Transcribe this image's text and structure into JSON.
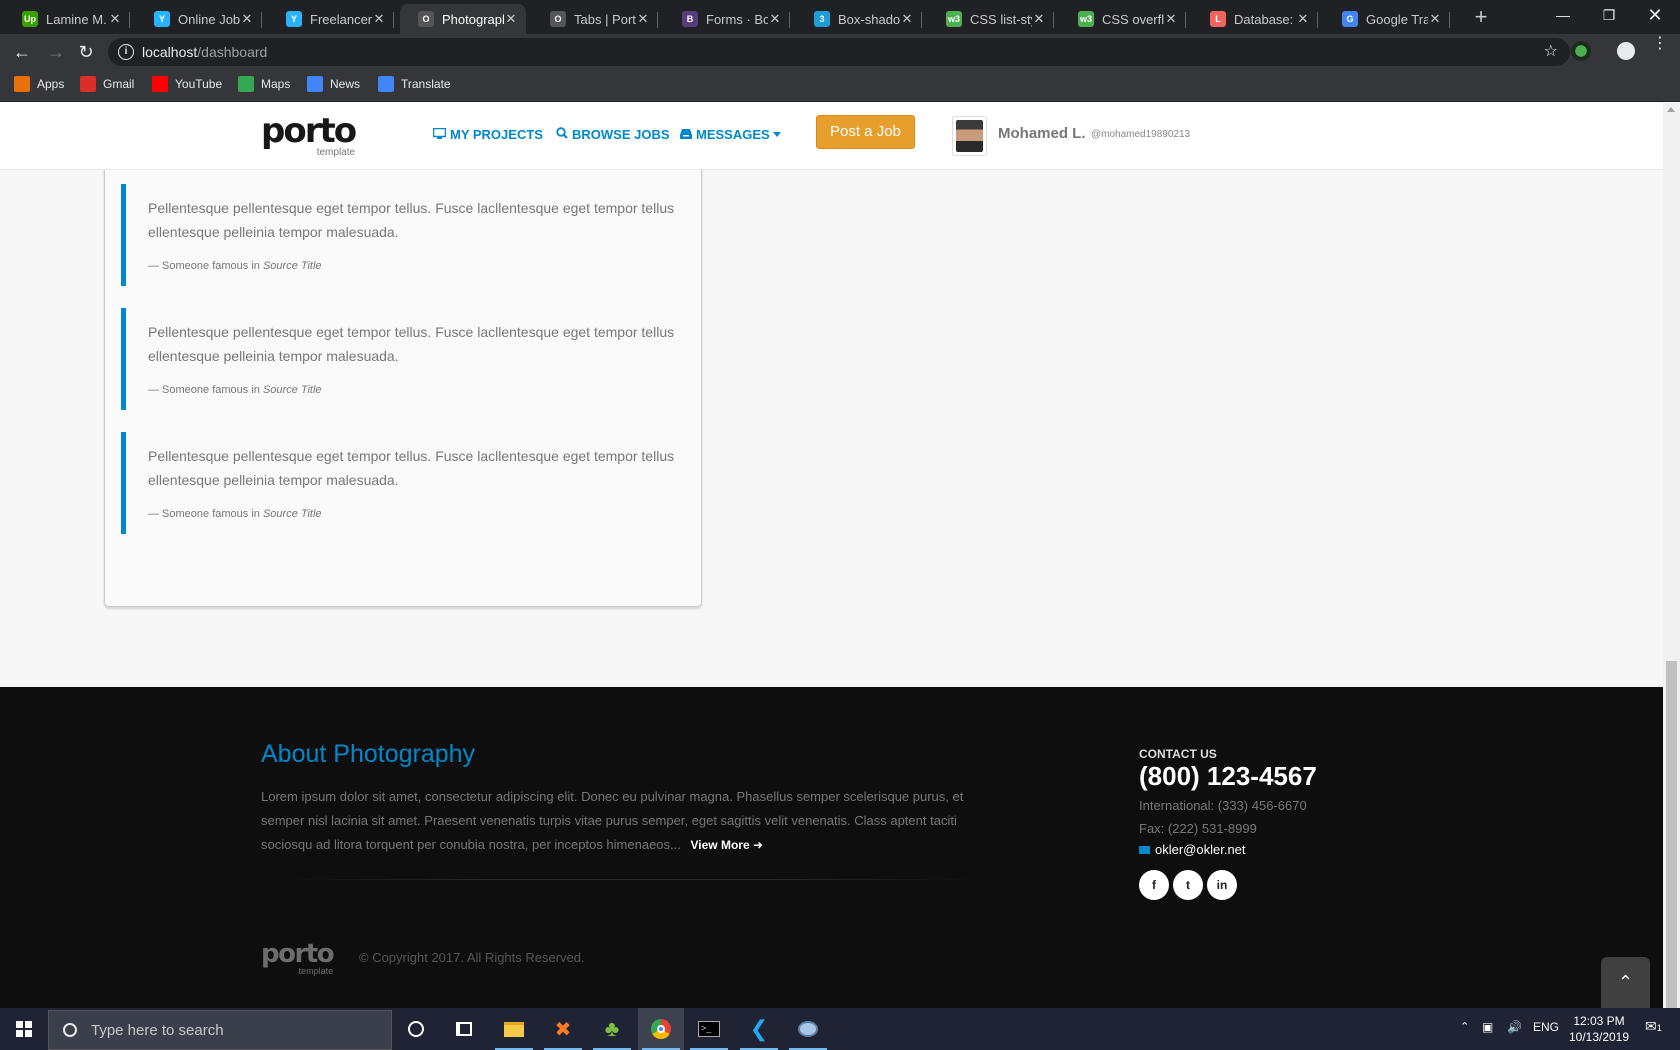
{
  "browser": {
    "tabs": [
      {
        "title": "Lamine M. - U",
        "icon": "upwork-icon",
        "color": "#37a000",
        "glyph": "Up"
      },
      {
        "title": "Online Jobs |",
        "icon": "freelancer-icon",
        "color": "#29b2fe",
        "glyph": "Y"
      },
      {
        "title": "Freelancer",
        "icon": "freelancer-icon",
        "color": "#29b2fe",
        "glyph": "Y"
      },
      {
        "title": "Photography",
        "icon": "porto-icon",
        "color": "#555555",
        "glyph": "O",
        "active": true
      },
      {
        "title": "Tabs | Porto",
        "icon": "porto-icon",
        "color": "#555555",
        "glyph": "O"
      },
      {
        "title": "Forms · Boot",
        "icon": "bootstrap-icon",
        "color": "#563d7c",
        "glyph": "B"
      },
      {
        "title": "Box-shadow",
        "icon": "css3-icon",
        "color": "#1e9ed6",
        "glyph": "3"
      },
      {
        "title": "CSS list-style",
        "icon": "w3schools-icon",
        "color": "#4caf50",
        "glyph": "w3"
      },
      {
        "title": "CSS overflow",
        "icon": "w3schools-icon",
        "color": "#4caf50",
        "glyph": "w3"
      },
      {
        "title": "Database: Se",
        "icon": "laravel-icon",
        "color": "#f4645f",
        "glyph": "L"
      },
      {
        "title": "Google Tran",
        "icon": "google-translate-icon",
        "color": "#4285f4",
        "glyph": "G"
      }
    ],
    "url_host": "localhost",
    "url_path": "/dashboard",
    "bookmarks": [
      {
        "label": "Apps",
        "icon": "apps-grid-icon",
        "color": "#e8710a"
      },
      {
        "label": "Gmail",
        "icon": "gmail-icon",
        "color": "#d93025"
      },
      {
        "label": "YouTube",
        "icon": "youtube-icon",
        "color": "#ff0000"
      },
      {
        "label": "Maps",
        "icon": "maps-icon",
        "color": "#34a853"
      },
      {
        "label": "News",
        "icon": "news-icon",
        "color": "#4285f4"
      },
      {
        "label": "Translate",
        "icon": "translate-icon",
        "color": "#4285f4"
      }
    ]
  },
  "header": {
    "logo": "porto",
    "logo_sub": "template",
    "nav": {
      "projects": "MY PROJECTS",
      "browse": "BROWSE JOBS",
      "messages": "MESSAGES"
    },
    "post_job": "Post a Job",
    "user_name": "Mohamed L.",
    "user_handle": "@mohamed19890213"
  },
  "quotes": {
    "text": "Pellentesque pellentesque eget tempor tellus. Fusce lacllentesque eget tempor tellus ellentesque pelleinia tempor malesuada.",
    "from": "— Someone famous in",
    "source": "Source Title"
  },
  "footer": {
    "about_title": "About Photography",
    "about_text": "Lorem ipsum dolor sit amet, consectetur adipiscing elit. Donec eu pulvinar magna. Phasellus semper scelerisque purus, et semper nisl lacinia sit amet. Praesent venenatis turpis vitae purus semper, eget sagittis velit venenatis. Class aptent taciti sociosqu ad litora torquent per conubia nostra, per inceptos himenaeos...",
    "view_more": "View More",
    "contact_heading": "CONTACT US",
    "phone": "(800) 123-4567",
    "international": "International: (333) 456-6670",
    "fax": "Fax: (222) 531-8999",
    "email": "okler@okler.net",
    "social": [
      "f",
      "t",
      "in"
    ],
    "logo": "porto",
    "logo_sub": "template",
    "copyright": "© Copyright 2017. All Rights Reserved."
  },
  "taskbar": {
    "search_placeholder": "Type here to search",
    "language": "ENG",
    "time": "12:03 PM",
    "date": "10/13/2019",
    "notifications": "1"
  }
}
